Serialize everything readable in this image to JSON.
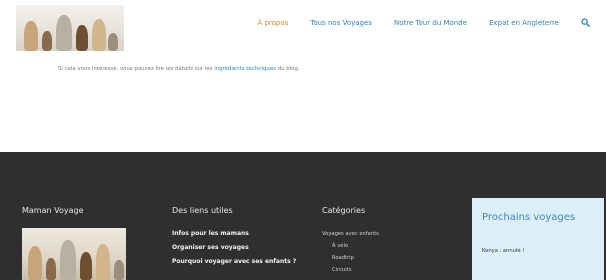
{
  "header": {
    "logo_alt": "Maman Voyage",
    "nav": [
      {
        "label": "À propos",
        "active": true
      },
      {
        "label": "Tous nos Voyages",
        "active": false
      },
      {
        "label": "Notre Tour du Monde",
        "active": false
      },
      {
        "label": "Expat en Angleterre",
        "active": false
      }
    ],
    "search_icon": "search-icon"
  },
  "content": {
    "text_before": "Si cela vous intéresse, vous pouvez lire les détails sur les ",
    "link": "ingrédients techniques",
    "text_after": " du blog."
  },
  "footer": {
    "col1_title": "Maman Voyage",
    "col2_title": "Des liens utiles",
    "col2_links": [
      "Infos pour les mamans",
      "Organiser ses voyages",
      "Pourquoi voyager avec ses enfants ?"
    ],
    "col3_title": "Catégories",
    "col3_category": "Voyages avec enfants",
    "col3_subs": [
      "À vélo",
      "Roadtrip",
      "Circuits"
    ],
    "widget_title": "Prochains voyages",
    "widget_text": "Kenya : annulé !"
  },
  "colors": {
    "accent": "#2b86c1",
    "active_nav": "#e0852b",
    "footer_bg": "#2f2f2f",
    "widget_bg": "#dceef8"
  }
}
